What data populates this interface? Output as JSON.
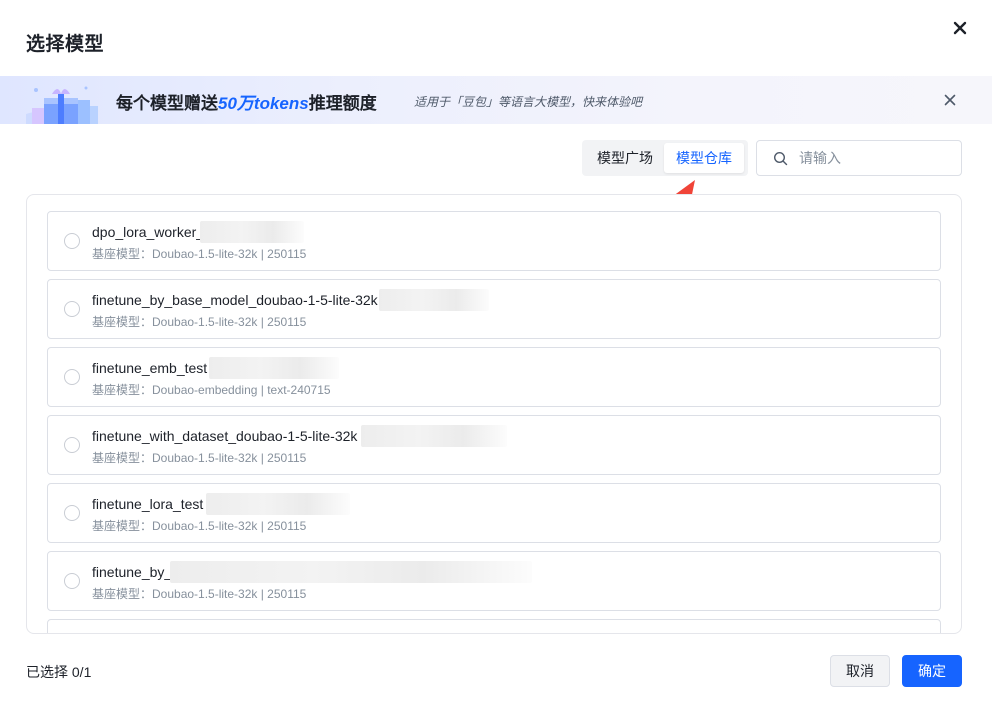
{
  "dialog": {
    "title": "选择模型",
    "close_icon": "close-icon"
  },
  "banner": {
    "title_prefix": "每个模型赠送",
    "title_highlight": "50万tokens",
    "title_suffix": "推理额度",
    "subtitle": "适用于「豆包」等语言大模型，快来体验吧",
    "close_icon": "close-icon"
  },
  "tabs": [
    {
      "label": "模型广场",
      "active": false
    },
    {
      "label": "模型仓库",
      "active": true
    }
  ],
  "search": {
    "placeholder": "请输入",
    "value": ""
  },
  "models": [
    {
      "name": "dpo_lora_worker_",
      "meta": "基座模型：Doubao-1.5-lite-32k | 250115"
    },
    {
      "name": "finetune_by_base_model_doubao-1-5-lite-32k",
      "meta": "基座模型：Doubao-1.5-lite-32k | 250115"
    },
    {
      "name": "finetune_emb_test",
      "meta": "基座模型：Doubao-embedding | text-240715"
    },
    {
      "name": "finetune_with_dataset_doubao-1-5-lite-32k",
      "meta": "基座模型：Doubao-1.5-lite-32k | 250115"
    },
    {
      "name": "finetune_lora_test",
      "meta": "基座模型：Doubao-1.5-lite-32k | 250115"
    },
    {
      "name": "finetune_by_",
      "meta": "基座模型：Doubao-1.5-lite-32k | 250115"
    }
  ],
  "footer": {
    "selected_status": "已选择 0/1",
    "cancel_label": "取消",
    "ok_label": "确定"
  },
  "colors": {
    "accent": "#1664ff",
    "annotation_arrow": "#f04438"
  }
}
